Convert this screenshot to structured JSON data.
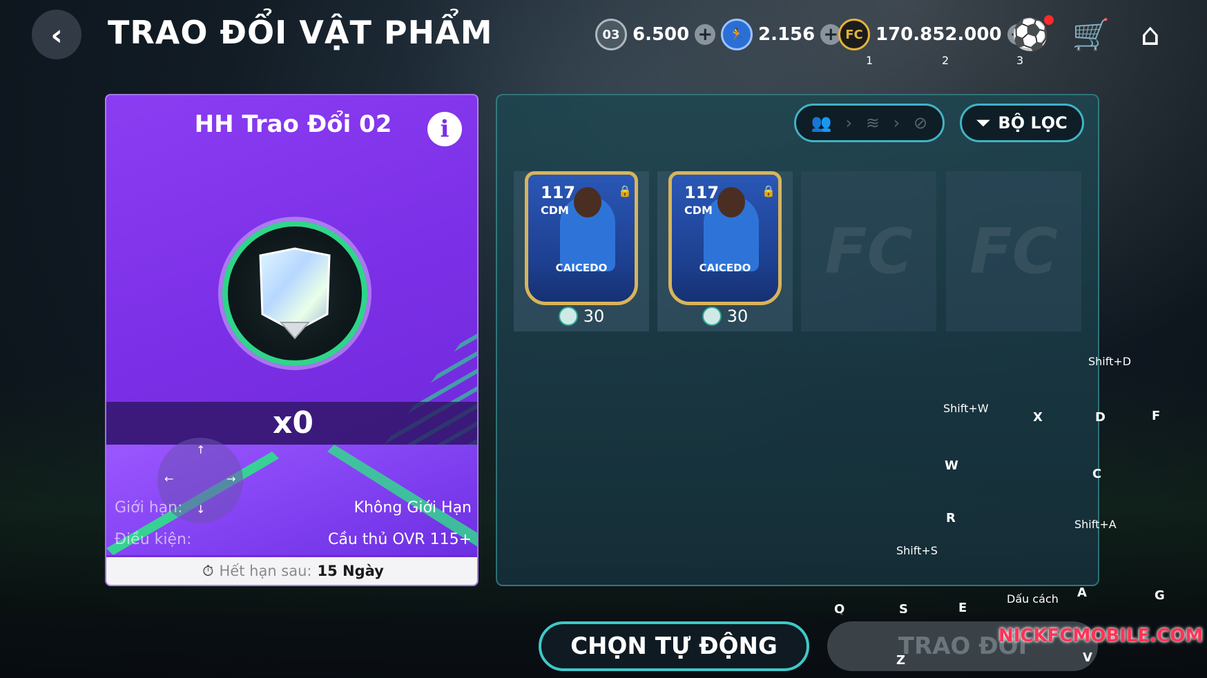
{
  "header": {
    "title": "TRAO ĐỔI VẬT PHẨM",
    "currencies": [
      {
        "label": "03",
        "value": "6.500"
      },
      {
        "value": "2.156"
      },
      {
        "value": "170.852.000"
      }
    ],
    "hotkeys": [
      "1",
      "2",
      "3"
    ]
  },
  "item": {
    "title": "HH Trao Đổi 02",
    "count": "x0",
    "limit_label": "Giới hạn:",
    "limit_value": "Không Giới Hạn",
    "condition_label": "Điều kiện:",
    "condition_value": "Cầu thủ OVR 115+",
    "expire_label": "Hết hạn sau:",
    "expire_value": "15 Ngày"
  },
  "filter": {
    "label": "BỘ LỌC"
  },
  "players": [
    {
      "ovr": "117",
      "pos": "CDM",
      "name": "CAICEDO",
      "price": "30"
    },
    {
      "ovr": "117",
      "pos": "CDM",
      "name": "CAICEDO",
      "price": "30"
    }
  ],
  "key_hints": [
    "Shift+D",
    "Shift+W",
    "X",
    "D",
    "F",
    "W",
    "C",
    "R",
    "Shift+A",
    "Shift+S",
    "Dấu cách",
    "A",
    "G",
    "Q",
    "S",
    "E",
    "Z",
    "V"
  ],
  "buttons": {
    "auto": "CHỌN TỰ ĐỘNG",
    "trade": "TRAO ĐỔI"
  },
  "watermark": "NICKFCMOBILE.COM",
  "colors": {
    "card_purple": "#7b2fe6",
    "accent_teal": "#3fc8c8",
    "badge_green": "#2fd58a",
    "watermark_red": "#ff3355"
  }
}
